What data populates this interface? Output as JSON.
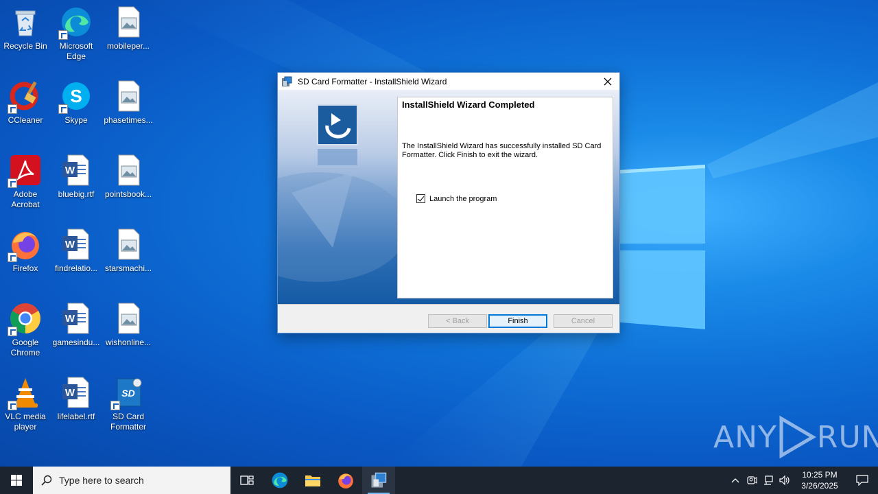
{
  "desktop": {
    "icons": [
      {
        "label": "Recycle Bin",
        "icon": "recycle-bin-icon"
      },
      {
        "label": "Microsoft Edge",
        "icon": "edge-icon"
      },
      {
        "label": "mobileper...",
        "icon": "image-file-icon"
      },
      {
        "label": "CCleaner",
        "icon": "ccleaner-icon"
      },
      {
        "label": "Skype",
        "icon": "skype-icon"
      },
      {
        "label": "phasetimes...",
        "icon": "image-file-icon"
      },
      {
        "label": "Adobe Acrobat",
        "icon": "acrobat-icon"
      },
      {
        "label": "bluebig.rtf",
        "icon": "word-doc-icon"
      },
      {
        "label": "pointsbook...",
        "icon": "image-file-icon"
      },
      {
        "label": "Firefox",
        "icon": "firefox-icon"
      },
      {
        "label": "findrelatio...",
        "icon": "word-doc-icon"
      },
      {
        "label": "starsmachi...",
        "icon": "image-file-icon"
      },
      {
        "label": "Google Chrome",
        "icon": "chrome-icon"
      },
      {
        "label": "gamesindu...",
        "icon": "word-doc-icon"
      },
      {
        "label": "wishonline...",
        "icon": "image-file-icon"
      },
      {
        "label": "VLC media player",
        "icon": "vlc-icon"
      },
      {
        "label": "lifelabel.rtf",
        "icon": "word-doc-icon"
      },
      {
        "label": "SD Card Formatter",
        "icon": "sd-card-icon"
      }
    ]
  },
  "dialog": {
    "title": "SD Card Formatter - InstallShield Wizard",
    "heading": "InstallShield Wizard Completed",
    "message": "The InstallShield Wizard has successfully installed SD Card Formatter. Click Finish to exit the wizard.",
    "checkbox_label": "Launch the program",
    "checkbox_checked": true,
    "back_label": "< Back",
    "finish_label": "Finish",
    "cancel_label": "Cancel"
  },
  "taskbar": {
    "search_placeholder": "Type here to search",
    "time": "10:25 PM",
    "date": "3/26/2025"
  },
  "watermark": {
    "text_left": "ANY",
    "text_right": "RUN"
  },
  "colors": {
    "accent": "#0078d7",
    "taskbar": "#1c2430"
  }
}
